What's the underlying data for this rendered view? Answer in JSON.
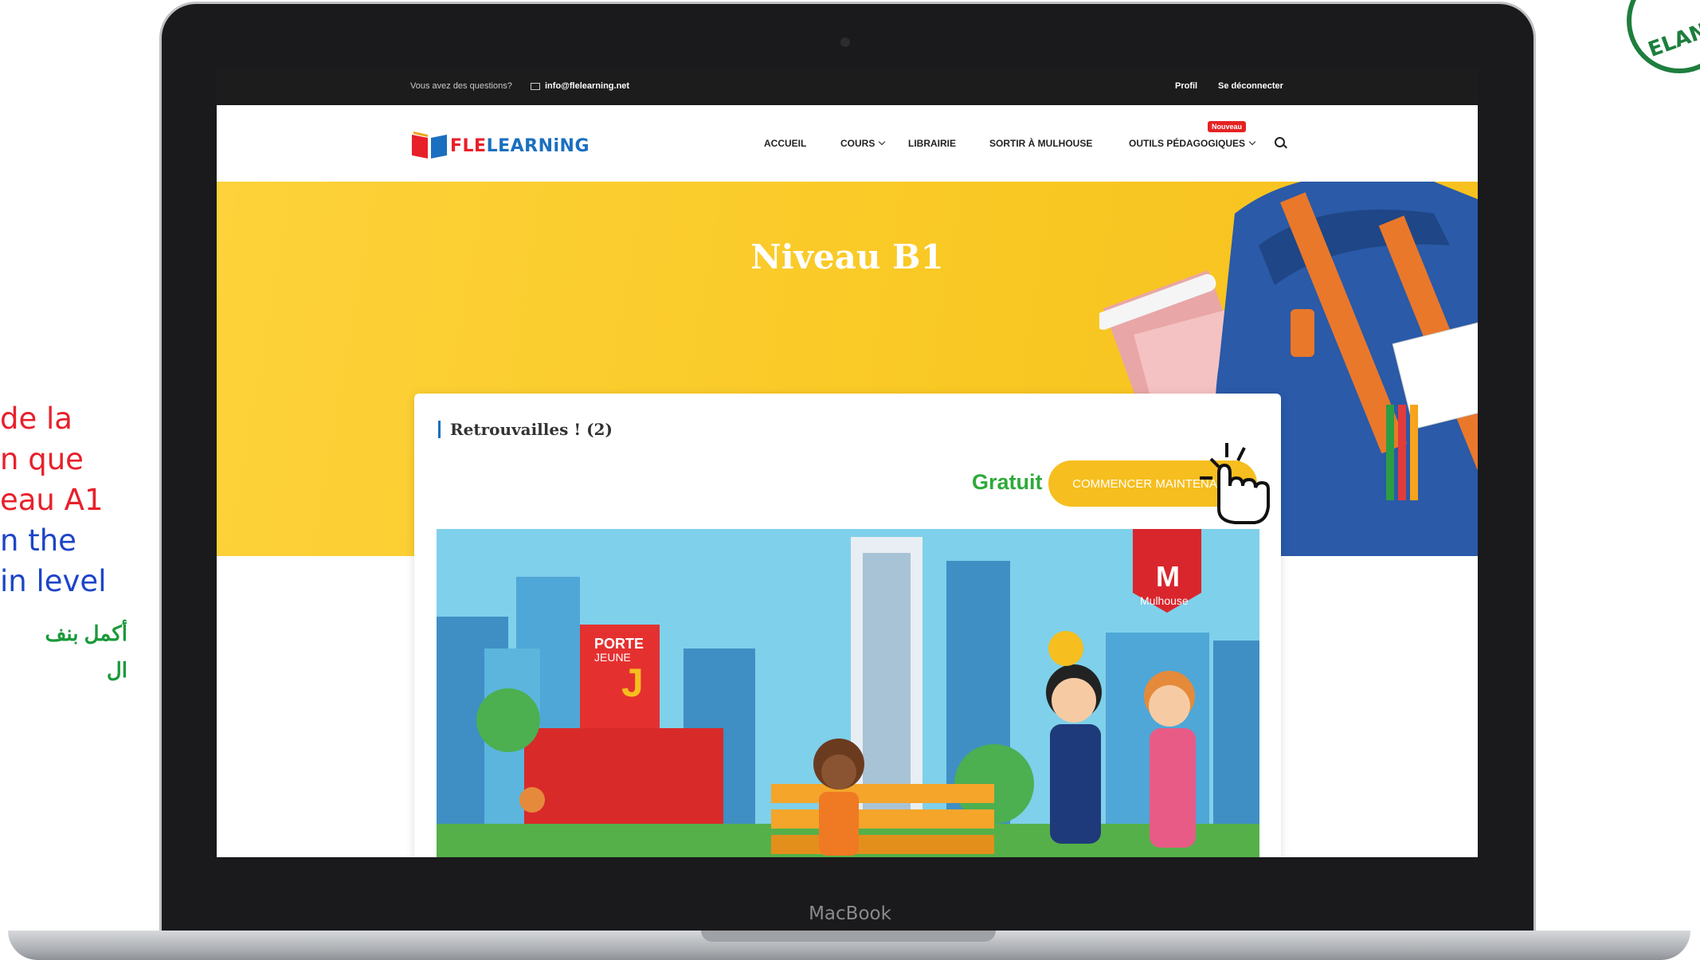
{
  "side_caption": {
    "french_lines": [
      "de la",
      "n que",
      "eau A1"
    ],
    "english_lines": [
      "n the",
      "in level"
    ],
    "arabic_lines": [
      "أكمل بنف",
      "ال"
    ]
  },
  "badge": {
    "text": "ELAN"
  },
  "laptop": {
    "brand": "MacBook"
  },
  "site": {
    "topbar": {
      "question": "Vous avez des questions?",
      "email": "info@flelearning.net",
      "profile_link": "Profil",
      "logout_link": "Se déconnecter"
    },
    "logo": {
      "text_fle": "FLE",
      "text_rest": "LEARNiNG"
    },
    "nav": {
      "accueil": "ACCUEIL",
      "cours": "COURS",
      "librairie": "LIBRAIRIE",
      "sortir": "SORTIR À MULHOUSE",
      "outils": "OUTILS PÉDAGOGIQUES",
      "new_badge": "Nouveau"
    },
    "hero": {
      "title": "Niveau B1"
    },
    "course": {
      "title": "Retrouvailles ! (2)",
      "price": "Gratuit",
      "start_button": "COMMENCER MAINTENANT"
    },
    "illustration": {
      "building_sign_1": "PORTE",
      "building_sign_2": "JEUNE",
      "building_letter": "J",
      "logo_letter": "M",
      "logo_label": "Mulhouse"
    }
  },
  "colors": {
    "hero_yellow": "#f9c823",
    "button_yellow": "#f6be1e",
    "price_green": "#2daa3a",
    "new_badge_red": "#e52222",
    "caption_red": "#e8202a",
    "caption_blue": "#1d45c8",
    "caption_green": "#1a9a3a"
  }
}
